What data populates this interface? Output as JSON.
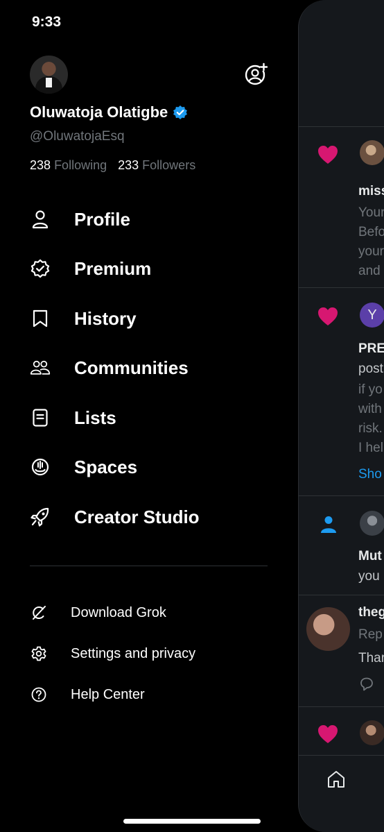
{
  "status_bar": {
    "time": "9:33"
  },
  "profile": {
    "name": "Oluwatoja Olatigbe",
    "handle": "@OluwatojaEsq",
    "following_count": "238",
    "following_label": "Following",
    "followers_count": "233",
    "followers_label": "Followers"
  },
  "nav": {
    "items": [
      {
        "label": "Profile",
        "icon": "person-icon"
      },
      {
        "label": "Premium",
        "icon": "verified-badge-icon"
      },
      {
        "label": "History",
        "icon": "bookmark-icon"
      },
      {
        "label": "Communities",
        "icon": "people-icon"
      },
      {
        "label": "Lists",
        "icon": "list-icon"
      },
      {
        "label": "Spaces",
        "icon": "spaces-icon"
      },
      {
        "label": "Creator Studio",
        "icon": "rocket-icon"
      }
    ]
  },
  "secondary": {
    "items": [
      {
        "label": "Download Grok",
        "icon": "grok-icon"
      },
      {
        "label": "Settings and privacy",
        "icon": "gear-icon"
      },
      {
        "label": "Help Center",
        "icon": "help-icon"
      }
    ]
  },
  "timeline": {
    "n1_name": "miss",
    "n1_line1": "Your",
    "n1_line2": "Befo",
    "n1_line3": "your",
    "n1_line4": "and",
    "n2_avatar_letter": "Y",
    "n2_line1": "PRE",
    "n2_line2": "post",
    "n2_line3": "if yo",
    "n2_line4": "with",
    "n2_line5": "risk.",
    "n2_line6": "I hel",
    "n2_show": "Sho",
    "n3_line1": "Mut",
    "n3_line2": "you",
    "n4_name": "theg",
    "n4_line1": "Rep",
    "n4_line2": "Thar"
  },
  "colors": {
    "background": "#000000",
    "accent": "#1d9bf0",
    "heart": "#f91880",
    "muted_text": "#71767b"
  }
}
